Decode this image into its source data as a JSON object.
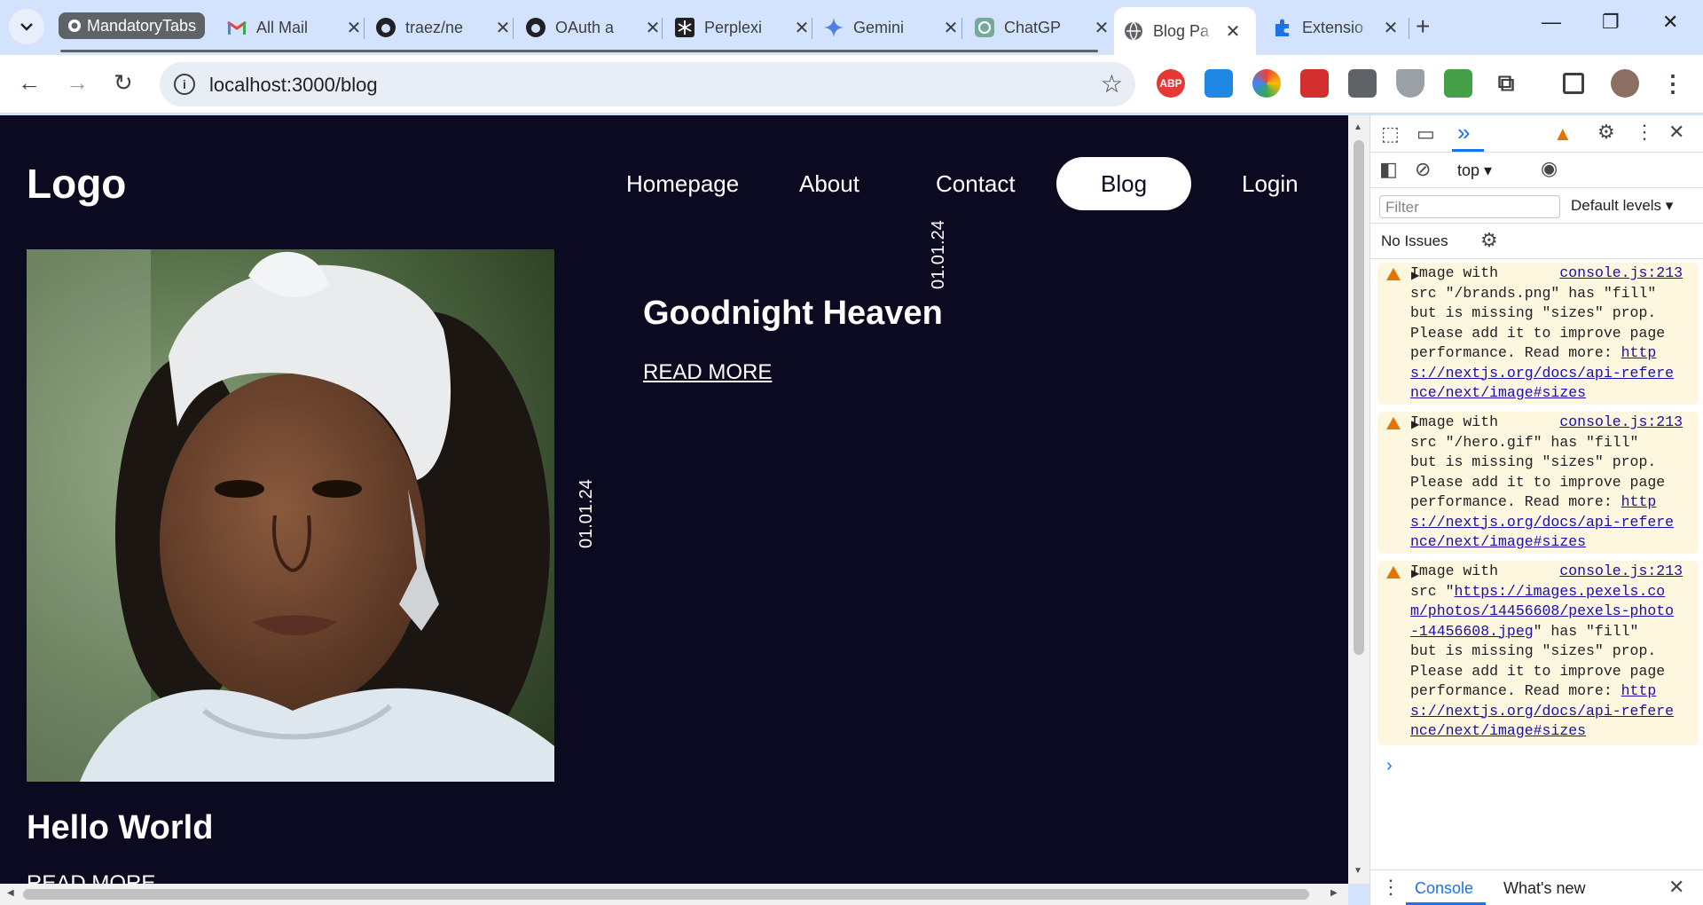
{
  "browser": {
    "tab_group_label": "MandatoryTabs",
    "tabs": [
      {
        "title": "All Mail",
        "icon": "gmail-icon"
      },
      {
        "title": "traez/ne",
        "icon": "github-icon"
      },
      {
        "title": "OAuth a",
        "icon": "github-icon"
      },
      {
        "title": "Perplexi",
        "icon": "perplexity-icon"
      },
      {
        "title": "Gemini",
        "icon": "gemini-icon"
      },
      {
        "title": "ChatGP",
        "icon": "chatgpt-icon"
      },
      {
        "title": "Blog Pa",
        "icon": "globe-icon",
        "active": true
      },
      {
        "title": "Extensio",
        "icon": "puzzle-icon"
      }
    ],
    "url": "localhost:3000/blog",
    "extensions": [
      "ABP"
    ]
  },
  "page": {
    "logo": "Logo",
    "nav": {
      "homepage": "Homepage",
      "about": "About",
      "contact": "Contact",
      "blog": "Blog",
      "login": "Login"
    },
    "posts": [
      {
        "title": "Hello World",
        "date": "01.01.24",
        "read_more": "READ MORE"
      },
      {
        "title": "Goodnight Heaven",
        "date": "01.01.24",
        "read_more": "READ MORE"
      }
    ]
  },
  "devtools": {
    "context": "top",
    "filter_placeholder": "Filter",
    "levels": "Default levels",
    "issues": "No Issues",
    "messages": [
      {
        "source": "console.js:213",
        "line1": "Image with",
        "text_pre": "src \"/brands.png\" has \"fill\"\nbut is missing \"sizes\" prop.\nPlease add it to improve page\nperformance. Read more: ",
        "link": "https://nextjs.org/docs/api-reference/next/image#sizes"
      },
      {
        "source": "console.js:213",
        "line1": "Image with",
        "text_pre": "src \"/hero.gif\" has \"fill\"\nbut is missing \"sizes\" prop.\nPlease add it to improve page\nperformance. Read more: ",
        "link": "https://nextjs.org/docs/api-reference/next/image#sizes"
      },
      {
        "source": "console.js:213",
        "line1": "Image with",
        "text_pre": "src \"",
        "src_link": "https://images.pexels.com/photos/14456608/pexels-photo-14456608.jpeg",
        "text_mid": "\" has \"fill\"\nbut is missing \"sizes\" prop.\nPlease add it to improve page\nperformance. Read more: ",
        "link": "https://nextjs.org/docs/api-reference/next/image#sizes"
      }
    ],
    "drawer_tabs": {
      "console": "Console",
      "whats_new": "What's new"
    }
  }
}
